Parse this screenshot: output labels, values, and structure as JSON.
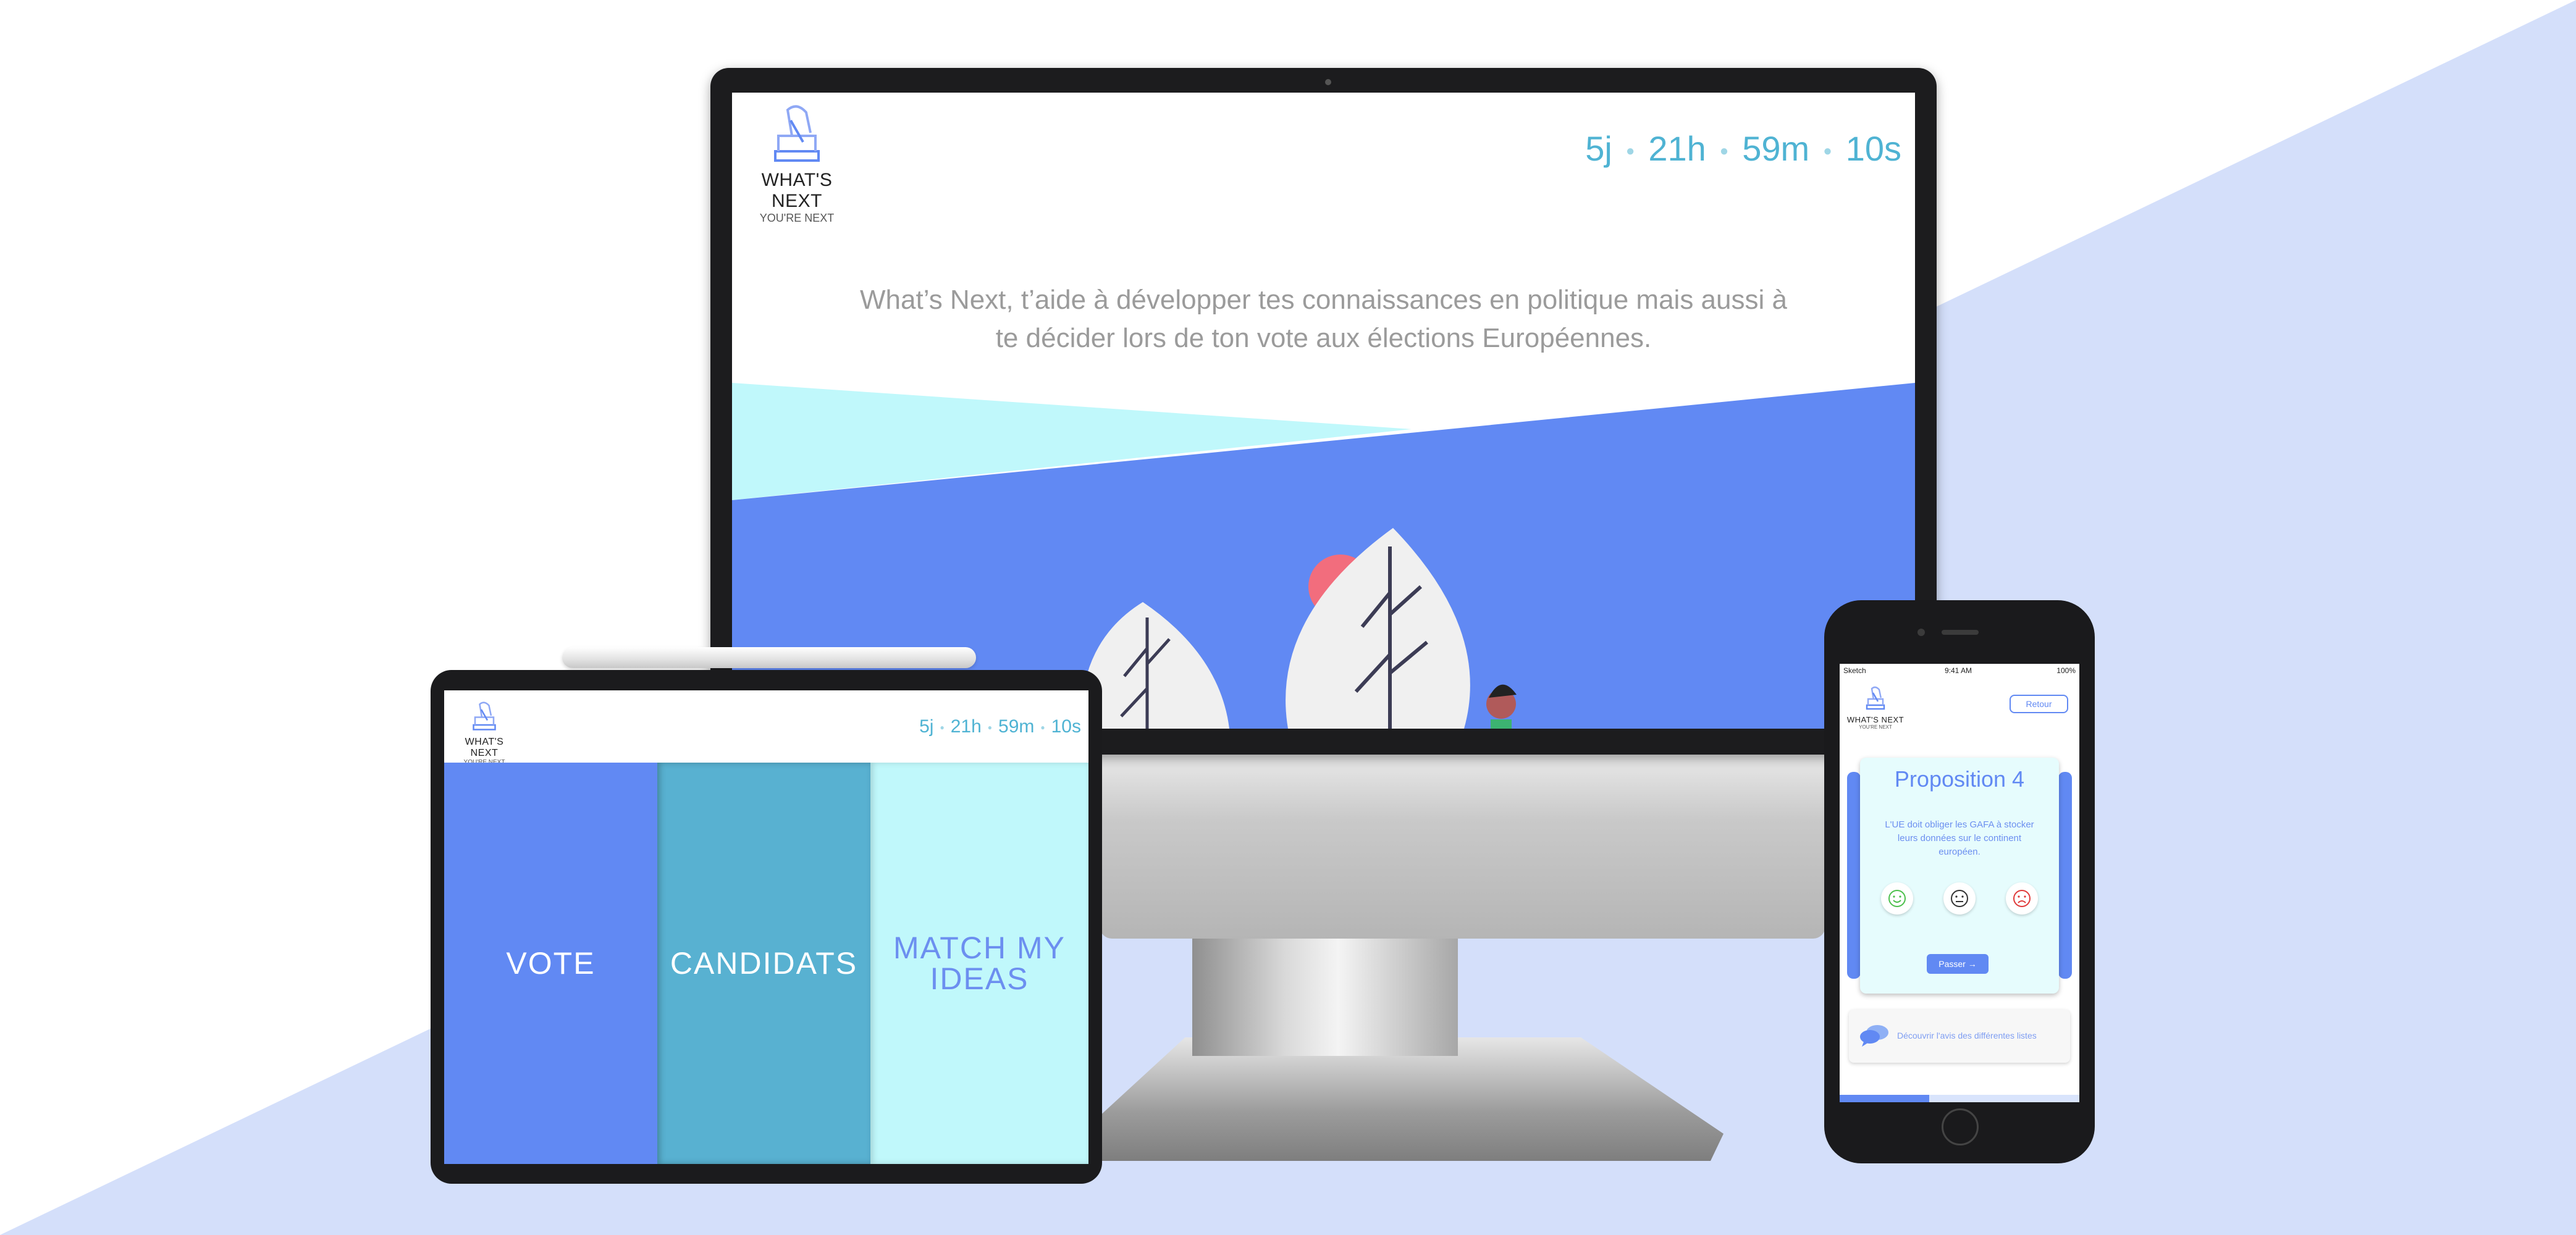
{
  "brand": {
    "name": "WHAT'S NEXT",
    "subtitle": "YOU'RE NEXT"
  },
  "colors": {
    "primary_blue": "#6189f3",
    "teal": "#58b1d1",
    "light_cyan": "#c0f8fb",
    "countdown": "#4fb3d3",
    "background_triangle": "#d4dffa",
    "accent_pink": "#f26d7d"
  },
  "countdown": {
    "days": "5j",
    "hours": "21h",
    "minutes": "59m",
    "seconds": "10s"
  },
  "desktop": {
    "tagline_line1": "What’s Next, t’aide à développer tes connaissances en politique mais aussi à",
    "tagline_line2": "te décider lors de ton vote aux élections Européennes."
  },
  "tablet": {
    "panels": [
      {
        "label": "VOTE"
      },
      {
        "label": "CANDIDATS"
      },
      {
        "label": "MATCH MY IDEAS"
      }
    ]
  },
  "phone": {
    "status": {
      "carrier": "Sketch",
      "time": "9:41 AM",
      "battery": "100%"
    },
    "back_label": "Retour",
    "proposition": {
      "title": "Proposition 4",
      "text": "L'UE doit obliger les GAFA à stocker leurs données sur le continent européen."
    },
    "reactions": [
      {
        "icon": "happy-face-icon",
        "color": "#4cc04c"
      },
      {
        "icon": "neutral-face-icon",
        "color": "#333333"
      },
      {
        "icon": "sad-face-icon",
        "color": "#e03a3a"
      }
    ],
    "skip_label": "Passer →",
    "opinion_text": "Découvrir l'avis des différentes listes"
  }
}
